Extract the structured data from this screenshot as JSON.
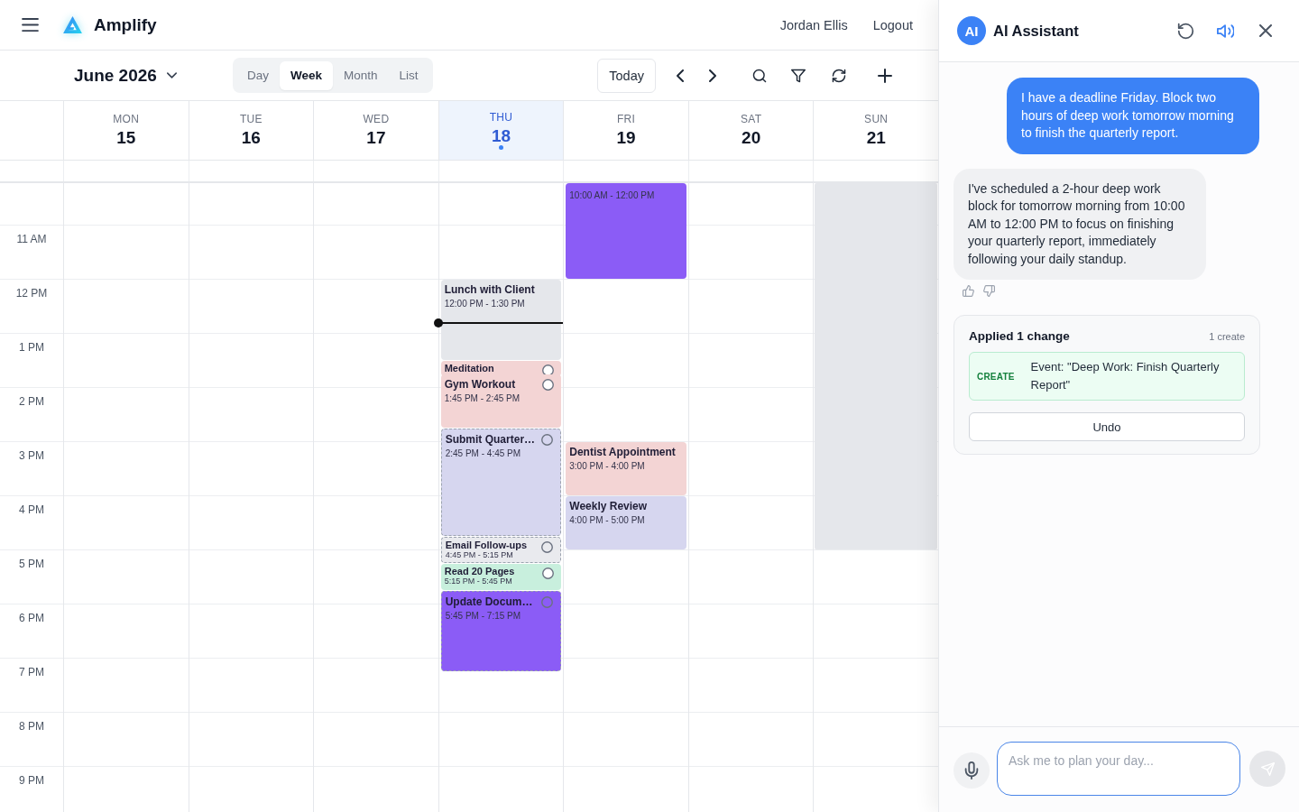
{
  "header": {
    "app_name": "Amplify",
    "user_name": "Jordan Ellis",
    "logout": "Logout"
  },
  "toolbar": {
    "period": "June 2026",
    "views": [
      {
        "label": "Day",
        "selected": false
      },
      {
        "label": "Week",
        "selected": true
      },
      {
        "label": "Month",
        "selected": false
      },
      {
        "label": "List",
        "selected": false
      }
    ],
    "today": "Today"
  },
  "calendar": {
    "days": [
      {
        "name": "MON",
        "date": "15",
        "today": false
      },
      {
        "name": "TUE",
        "date": "16",
        "today": false
      },
      {
        "name": "WED",
        "date": "17",
        "today": false
      },
      {
        "name": "THU",
        "date": "18",
        "today": true,
        "events": [
          {
            "kind": "event",
            "title": "Lunch with Client",
            "time": "12:00 PM - 1:30 PM",
            "color": "#e5e7eb",
            "dashed": false
          },
          {
            "kind": "task",
            "title": "Meditation",
            "color": "#f3d4d4",
            "dashed": false,
            "checked": false
          },
          {
            "kind": "task",
            "title": "Gym Workout",
            "time": "1:45 PM - 2:45 PM",
            "color": "#f3d4d4",
            "dashed": false,
            "checked": false
          },
          {
            "kind": "task",
            "title": "Submit Quarter…",
            "time": "2:45 PM - 4:45 PM",
            "color": "#d6d6ef",
            "dashed": true,
            "checked": false
          },
          {
            "kind": "task",
            "title": "Email Follow-ups",
            "time": "4:45 PM - 5:15 PM",
            "color": "#e9eaee",
            "dashed": true,
            "checked": false
          },
          {
            "kind": "task",
            "title": "Read 20 Pages",
            "time": "5:15 PM - 5:45 PM",
            "color": "#c8efdd",
            "dashed": false,
            "checked": false
          },
          {
            "kind": "task",
            "title": "Update Docum…",
            "time": "5:45 PM - 7:15 PM",
            "color": "#8b5cf6",
            "dashed": true,
            "checked": false
          }
        ]
      },
      {
        "name": "FRI",
        "date": "19",
        "today": false,
        "events": [
          {
            "kind": "event",
            "time": "10:00 AM - 12:00 PM",
            "color": "#8b5cf6",
            "dashed": false
          },
          {
            "kind": "event",
            "title": "Dentist Appointment",
            "time": "3:00 PM - 4:00 PM",
            "color": "#f3d4d4",
            "dashed": false
          },
          {
            "kind": "event",
            "title": "Weekly Review",
            "time": "4:00 PM - 5:00 PM",
            "color": "#d6d6ef",
            "dashed": false
          }
        ]
      },
      {
        "name": "SAT",
        "date": "20",
        "today": false
      },
      {
        "name": "SUN",
        "date": "21",
        "today": false,
        "events": [
          {
            "kind": "block",
            "color": "#e5e7eb",
            "dashed": false
          }
        ]
      }
    ],
    "hours": [
      "11 AM",
      "12 PM",
      "1 PM",
      "2 PM",
      "3 PM",
      "4 PM",
      "5 PM",
      "6 PM",
      "7 PM",
      "8 PM",
      "9 PM"
    ]
  },
  "assistant": {
    "avatar": "AI",
    "title": "AI Assistant",
    "voice_on": true,
    "messages": [
      {
        "kind": "user",
        "text": "I have a deadline Friday. Block two hours of deep work tomorrow morning to finish the quarterly report."
      },
      {
        "kind": "assistant",
        "text": "I've scheduled a 2-hour deep work block for tomorrow morning from 10:00 AM to 12:00 PM to focus on finishing your quarterly report, immediately following your daily standup."
      }
    ],
    "change_card": {
      "title": "Applied 1 change",
      "count": "1 create",
      "changes": [
        {
          "action": "CREATE",
          "text": "Event: \"Deep Work: Finish Quarterly Report\""
        }
      ],
      "undo": "Undo"
    },
    "input": {
      "placeholder": "Ask me to plan your day..."
    }
  }
}
